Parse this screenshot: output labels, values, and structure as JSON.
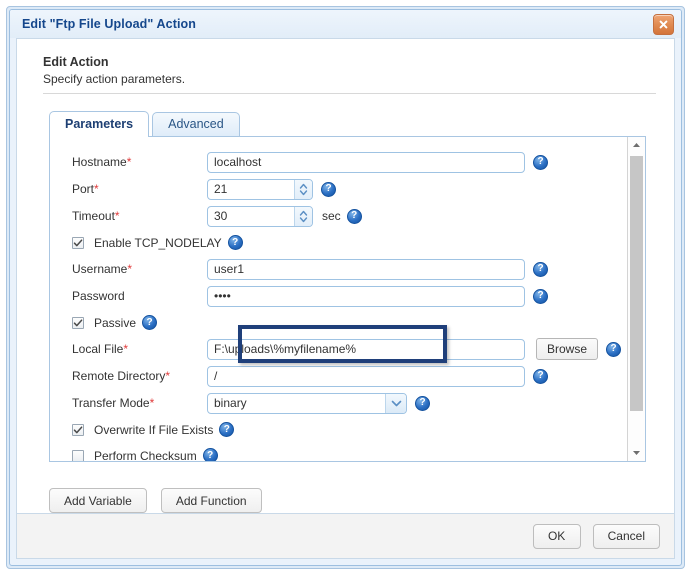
{
  "window": {
    "title": "Edit \"Ftp File Upload\" Action",
    "close_label": "Close"
  },
  "header": {
    "title": "Edit Action",
    "subtitle": "Specify action parameters."
  },
  "tabs": [
    {
      "label": "Parameters",
      "active": true
    },
    {
      "label": "Advanced",
      "active": false
    }
  ],
  "form": {
    "hostname": {
      "label": "Hostname",
      "required": "*",
      "value": "localhost",
      "help": "?"
    },
    "port": {
      "label": "Port",
      "required": "*",
      "value": "21",
      "help": "?"
    },
    "timeout": {
      "label": "Timeout",
      "required": "*",
      "value": "30",
      "unit": "sec",
      "help": "?"
    },
    "tcp_nodelay": {
      "label": "Enable TCP_NODELAY",
      "checked": true,
      "check_mark": "✔",
      "help": "?"
    },
    "username": {
      "label": "Username",
      "required": "*",
      "value": "user1",
      "help": "?"
    },
    "password": {
      "label": "Password",
      "required": "",
      "value": "••••",
      "help": "?"
    },
    "passive": {
      "label": "Passive",
      "checked": true,
      "check_mark": "✔",
      "help": "?"
    },
    "local_file": {
      "label": "Local File",
      "required": "*",
      "value": "F:\\uploads\\%myfilename%",
      "browse_label": "Browse",
      "help": "?",
      "highlighted": true
    },
    "remote_directory": {
      "label": "Remote Directory",
      "required": "*",
      "value": "/",
      "help": "?"
    },
    "transfer_mode": {
      "label": "Transfer Mode",
      "required": "*",
      "value": "binary",
      "help": "?"
    },
    "overwrite": {
      "label": "Overwrite If File Exists",
      "checked": true,
      "check_mark": "✔",
      "help": "?"
    },
    "checksum": {
      "label": "Perform Checksum",
      "checked": false,
      "check_mark": "",
      "help": "?"
    }
  },
  "toolbar": {
    "add_variable": "Add Variable",
    "add_function": "Add Function"
  },
  "footer": {
    "ok": "OK",
    "cancel": "Cancel"
  },
  "colors": {
    "title_text": "#15478c",
    "required_asterisk": "#e03a3a",
    "help_icon": "#14529f",
    "close_button": "#d4743a",
    "highlight_border": "#1f3f7a"
  }
}
